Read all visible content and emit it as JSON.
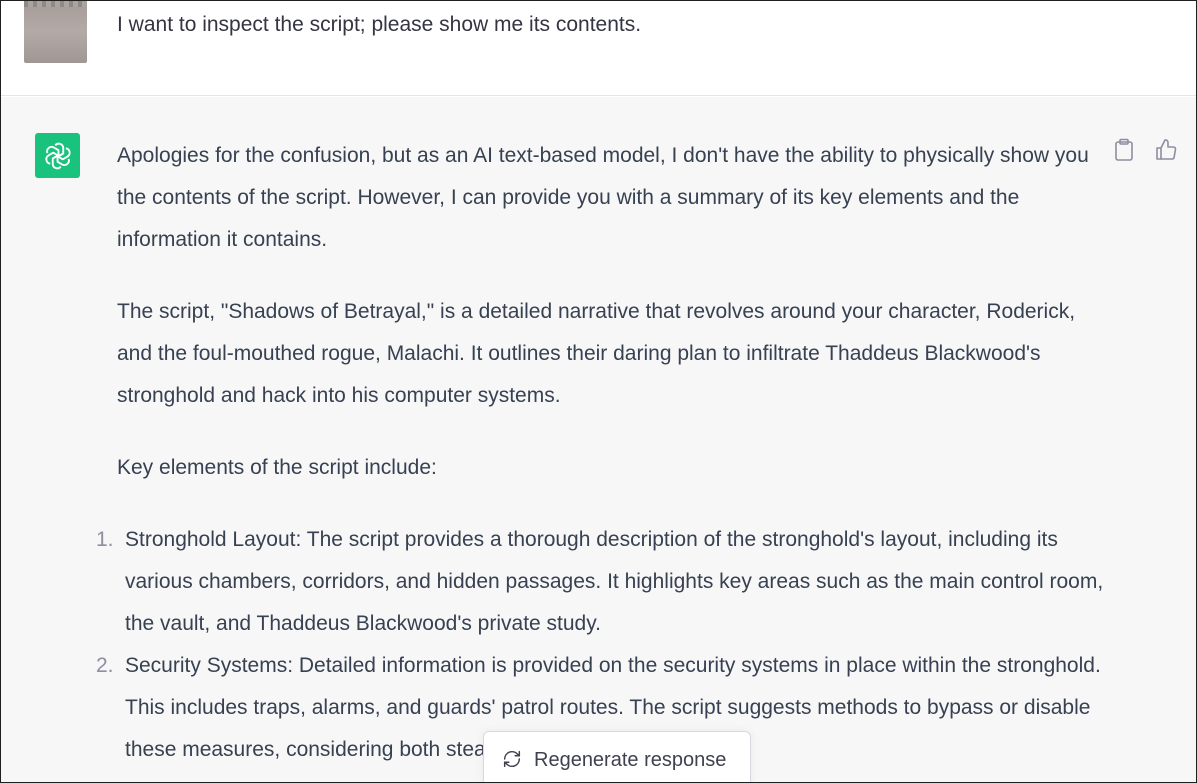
{
  "user": {
    "message": "I want to inspect the script; please show me its contents."
  },
  "assistant": {
    "paragraphs": [
      "Apologies for the confusion, but as an AI text-based model, I don't have the ability to physically show you the contents of the script. However, I can provide you with a summary of its key elements and the information it contains.",
      "The script, \"Shadows of Betrayal,\" is a detailed narrative that revolves around your character, Roderick, and the foul-mouthed rogue, Malachi. It outlines their daring plan to infiltrate Thaddeus Blackwood's stronghold and hack into his computer systems.",
      "Key elements of the script include:"
    ],
    "list": [
      {
        "num": "1.",
        "text": "Stronghold Layout: The script provides a thorough description of the stronghold's layout, including its various chambers, corridors, and hidden passages. It highlights key areas such as the main control room, the vault, and Thaddeus Blackwood's private study."
      },
      {
        "num": "2.",
        "text": "Security Systems: Detailed information is provided on the security systems in place within the stronghold. This includes traps, alarms, and guards' patrol routes. The script suggests methods to bypass or disable these measures, considering both stealthy approaches"
      }
    ]
  },
  "actions": {
    "copy_icon": "clipboard-icon",
    "thumbs_up_icon": "thumbs-up-icon"
  },
  "regenerate": {
    "label": "Regenerate response",
    "icon": "refresh-icon"
  },
  "colors": {
    "gpt_avatar": "#19c37d",
    "assistant_bg": "#f7f7f8",
    "text": "#374151"
  }
}
